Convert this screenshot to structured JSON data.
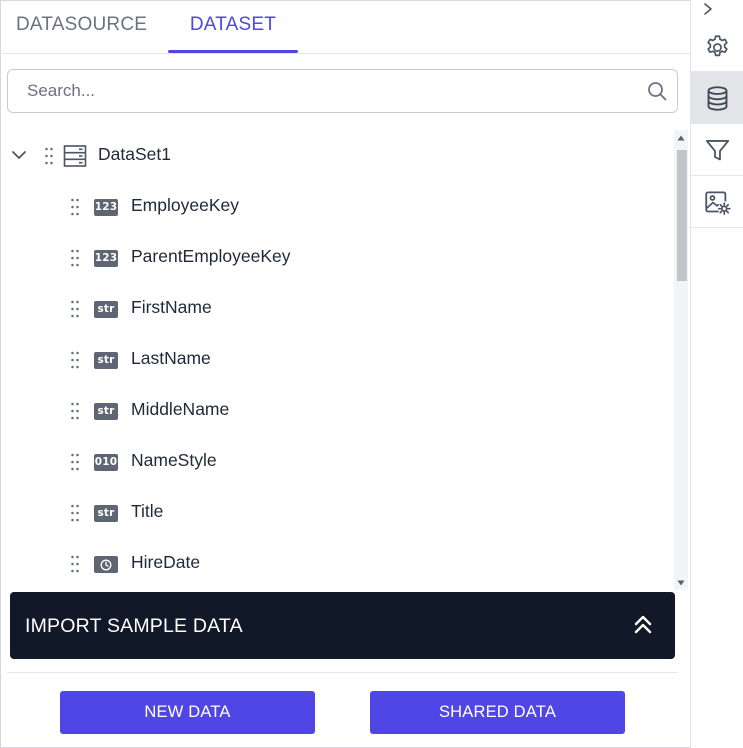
{
  "tabs": [
    {
      "label": "DATASOURCE",
      "active": false
    },
    {
      "label": "DATASET",
      "active": true
    }
  ],
  "search": {
    "placeholder": "Search...",
    "value": ""
  },
  "dataset": {
    "name": "DataSet1",
    "expanded": true,
    "fields": [
      {
        "name": "EmployeeKey",
        "type": "123"
      },
      {
        "name": "ParentEmployeeKey",
        "type": "123"
      },
      {
        "name": "FirstName",
        "type": "str"
      },
      {
        "name": "LastName",
        "type": "str"
      },
      {
        "name": "MiddleName",
        "type": "str"
      },
      {
        "name": "NameStyle",
        "type": "010"
      },
      {
        "name": "Title",
        "type": "str"
      },
      {
        "name": "HireDate",
        "type": "clock-icon"
      }
    ]
  },
  "import_banner": {
    "label": "IMPORT SAMPLE DATA"
  },
  "buttons": {
    "new_data": "NEW DATA",
    "shared_data": "SHARED DATA"
  },
  "rail": {
    "items": [
      {
        "icon": "gear-icon",
        "active": false
      },
      {
        "icon": "database-icon",
        "active": true
      },
      {
        "icon": "filter-icon",
        "active": false
      },
      {
        "icon": "image-settings-icon",
        "active": false
      }
    ]
  },
  "colors": {
    "accent": "#4f46e5",
    "banner": "#111827",
    "badge": "#5f6673"
  }
}
